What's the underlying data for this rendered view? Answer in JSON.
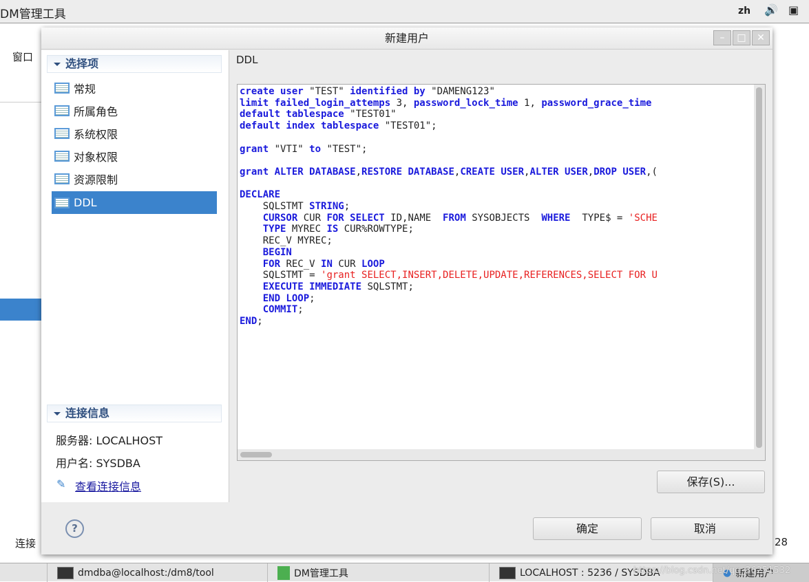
{
  "topbar": {
    "app_title": "DM管理工具",
    "lang": "zh"
  },
  "bg": {
    "menu_window": "窗口",
    "status_left": "连接",
    "status_right": "28"
  },
  "taskbar": {
    "items": [
      "dmdba@localhost:/dm8/tool",
      "DM管理工具",
      "LOCALHOST : 5236 / SYSDBA",
      "新建用户"
    ],
    "watermark": "https://blog.csdn.net/qq_36251532"
  },
  "dialog": {
    "title": "新建用户",
    "sidebar": {
      "section_title": "选择项",
      "items": [
        {
          "label": "常规"
        },
        {
          "label": "所属角色"
        },
        {
          "label": "系统权限"
        },
        {
          "label": "对象权限"
        },
        {
          "label": "资源限制"
        },
        {
          "label": "DDL",
          "selected": true
        }
      ]
    },
    "connection": {
      "section_title": "连接信息",
      "server": "服务器: LOCALHOST",
      "user": "用户名: SYSDBA",
      "link": "查看连接信息"
    },
    "ddl_title": "DDL",
    "code_lines": [
      [
        [
          "kw",
          "create user"
        ],
        [
          "tx",
          " \"TEST\" "
        ],
        [
          "kw",
          "identified by"
        ],
        [
          "tx",
          " \"DAMENG123\""
        ]
      ],
      [
        [
          "kw",
          "limit failed_login_attemps"
        ],
        [
          "tx",
          " 3, "
        ],
        [
          "kw",
          "password_lock_time"
        ],
        [
          "tx",
          " 1, "
        ],
        [
          "kw",
          "password_grace_time"
        ]
      ],
      [
        [
          "kw",
          "default tablespace"
        ],
        [
          "tx",
          " \"TEST01\""
        ]
      ],
      [
        [
          "kw",
          "default index tablespace"
        ],
        [
          "tx",
          " \"TEST01\";"
        ]
      ],
      [],
      [
        [
          "kw",
          "grant"
        ],
        [
          "tx",
          " \"VTI\" "
        ],
        [
          "kw",
          "to"
        ],
        [
          "tx",
          " \"TEST\";"
        ]
      ],
      [],
      [
        [
          "kw",
          "grant ALTER DATABASE"
        ],
        [
          "tx",
          ","
        ],
        [
          "kw",
          "RESTORE DATABASE"
        ],
        [
          "tx",
          ","
        ],
        [
          "kw",
          "CREATE USER"
        ],
        [
          "tx",
          ","
        ],
        [
          "kw",
          "ALTER USER"
        ],
        [
          "tx",
          ","
        ],
        [
          "kw",
          "DROP USER"
        ],
        [
          "tx",
          ",("
        ]
      ],
      [],
      [
        [
          "kw",
          "DECLARE"
        ]
      ],
      [
        [
          "tx",
          "    SQLSTMT "
        ],
        [
          "kw",
          "STRING"
        ],
        [
          "tx",
          ";"
        ]
      ],
      [
        [
          "tx",
          "    "
        ],
        [
          "kw",
          "CURSOR"
        ],
        [
          "tx",
          " CUR "
        ],
        [
          "kw",
          "FOR SELECT"
        ],
        [
          "tx",
          " ID,NAME  "
        ],
        [
          "kw",
          "FROM"
        ],
        [
          "tx",
          " SYSOBJECTS  "
        ],
        [
          "kw",
          "WHERE"
        ],
        [
          "tx",
          "  TYPE$ = "
        ],
        [
          "st",
          "'SCHE"
        ]
      ],
      [
        [
          "tx",
          "    "
        ],
        [
          "kw",
          "TYPE"
        ],
        [
          "tx",
          " MYREC "
        ],
        [
          "kw",
          "IS"
        ],
        [
          "tx",
          " CUR%ROWTYPE;"
        ]
      ],
      [
        [
          "tx",
          "    REC_V MYREC;"
        ]
      ],
      [
        [
          "tx",
          "    "
        ],
        [
          "kw",
          "BEGIN"
        ]
      ],
      [
        [
          "tx",
          "    "
        ],
        [
          "kw",
          "FOR"
        ],
        [
          "tx",
          " REC_V "
        ],
        [
          "kw",
          "IN"
        ],
        [
          "tx",
          " CUR "
        ],
        [
          "kw",
          "LOOP"
        ]
      ],
      [
        [
          "tx",
          "    SQLSTMT = "
        ],
        [
          "st",
          "'grant SELECT,INSERT,DELETE,UPDATE,REFERENCES,SELECT FOR U"
        ]
      ],
      [
        [
          "tx",
          "    "
        ],
        [
          "kw",
          "EXECUTE IMMEDIATE"
        ],
        [
          "tx",
          " SQLSTMT;"
        ]
      ],
      [
        [
          "tx",
          "    "
        ],
        [
          "kw",
          "END LOOP"
        ],
        [
          "tx",
          ";"
        ]
      ],
      [
        [
          "tx",
          "    "
        ],
        [
          "kw",
          "COMMIT"
        ],
        [
          "tx",
          ";"
        ]
      ],
      [
        [
          "kw",
          "END"
        ],
        [
          "tx",
          ";"
        ]
      ]
    ],
    "save_button": "保存(S)...",
    "ok_button": "确定",
    "cancel_button": "取消"
  },
  "colors": {
    "keyword": "#1a1adc",
    "string": "#e82020",
    "selection": "#3b83cc"
  }
}
